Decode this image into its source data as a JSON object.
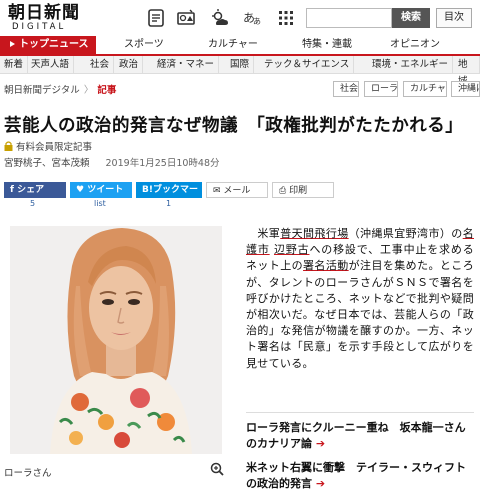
{
  "header": {
    "logo_ja": "朝日新聞",
    "logo_en": "DIGITAL",
    "search_label": "検索",
    "toc_label": "目次",
    "icons": [
      "briefing-icon",
      "sports-icon",
      "weather-icon",
      "font-size-icon",
      "grid-menu-icon"
    ]
  },
  "mainnav": {
    "items": [
      "トップニュース",
      "スポーツ",
      "カルチャー",
      "特集・連載",
      "オピニオン"
    ]
  },
  "subnav": {
    "items": [
      "新着",
      "天声人語",
      "社会",
      "政治",
      "経済・マネー",
      "国際",
      "テック＆サイエンス",
      "環境・エネルギー",
      "地域"
    ]
  },
  "breadcrumb": {
    "home": "朝日新聞デジタル",
    "current": "記事"
  },
  "tags": [
    "社会",
    "ローラ",
    "カルチャー",
    "沖縄はいま"
  ],
  "article": {
    "title": "芸能人の政治的発言なぜ物議　「政権批判がたたかれる」",
    "member_label": "有料会員限定記事",
    "authors": "宮野桃子、宮本茂頼",
    "date": "2019年1月25日10時48分",
    "caption": "ローラさん",
    "body_parts": [
      "　米軍",
      "普天間飛行場",
      "（沖縄県宜野湾市）の",
      "名護市",
      "辺野古",
      "への移設で、工事中止を求めるネット上の",
      "署名活動",
      "が注目を集めた。ところが、タレントのローラさんがＳＮＳで署名を呼びかけたところ、ネットなどで批判や疑問が相次いだ。なぜ日本では、芸能人らの「政治的」な発信が物議を醸すのか。一方、ネット署名は「民意」を示す手段として広がりを見せている。"
    ]
  },
  "share": {
    "facebook": "シェア",
    "facebook_count": "5",
    "twitter": "ツイート",
    "twitter_count": "list",
    "hatena": "ブックマーク",
    "hatena_prefix": "B!",
    "hatena_count": "1",
    "mail": "メール",
    "print": "印刷"
  },
  "related": [
    "ローラ発言にクルーニー重ね　坂本龍一さんのカナリア論",
    "米ネット右翼に衝撃　テイラー・スウィフトの政治的発言"
  ],
  "colors": {
    "brand_red": "#c8161d",
    "facebook": "#3b5998",
    "twitter": "#1da1f2",
    "hatena": "#008fde"
  }
}
